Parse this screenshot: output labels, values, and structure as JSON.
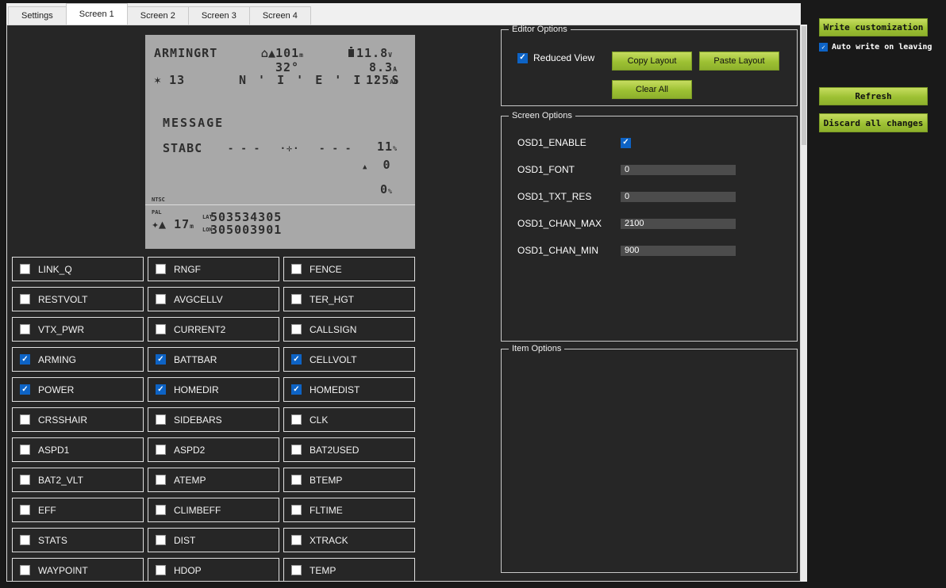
{
  "colors": {
    "accent_green": "#9cc033",
    "checkbox_checked_fill": "#0d63c5",
    "panel_bg": "#262626",
    "window_bg": "#191919",
    "preview_bg": "#a8a8a8",
    "bar_bg": "#4c4c4c"
  },
  "tabs": {
    "items": [
      {
        "label": "Settings",
        "selected": false
      },
      {
        "label": "Screen 1",
        "selected": true
      },
      {
        "label": "Screen 2",
        "selected": false
      },
      {
        "label": "Screen 3",
        "selected": false
      },
      {
        "label": "Screen 4",
        "selected": false
      }
    ]
  },
  "osd": {
    "arming": "ARMINGRT",
    "home_alt": "101",
    "home_alt_unit": "m",
    "heading": "32°",
    "volts": "11.8",
    "volts_unit": "V",
    "amps": "8.3",
    "amps_unit": "A",
    "mah": "125",
    "mah_unit": "Ah",
    "sats": "13",
    "compass": "N ' I ' E ' I ' S",
    "message": "MESSAGE",
    "mode": "STABC",
    "crosshair": "- - -   ·✛·   - - -",
    "rssi": "11",
    "rssi_unit": "%",
    "vspeed": "0",
    "throttle": "0",
    "throttle_unit": "%",
    "ntsc_label": "NTSC",
    "pal_label": "PAL",
    "wind": "17",
    "wind_unit": "m",
    "lat_label": "LAT",
    "lat": "503534305",
    "lon_label": "LON",
    "lon": "305003901",
    "icons": {
      "home_arrow": "⌂▲",
      "satellite": "✶",
      "wind": "✦▲",
      "vspeed_arrow": "▲"
    }
  },
  "items": {
    "columns": [
      [
        {
          "label": "LINK_Q",
          "checked": false
        },
        {
          "label": "RESTVOLT",
          "checked": false
        },
        {
          "label": "VTX_PWR",
          "checked": false
        },
        {
          "label": "ARMING",
          "checked": true
        },
        {
          "label": "POWER",
          "checked": true
        },
        {
          "label": "CRSSHAIR",
          "checked": false
        },
        {
          "label": "ASPD1",
          "checked": false
        },
        {
          "label": "BAT2_VLT",
          "checked": false
        },
        {
          "label": "EFF",
          "checked": false
        },
        {
          "label": "STATS",
          "checked": false
        },
        {
          "label": "WAYPOINT",
          "checked": false
        }
      ],
      [
        {
          "label": "RNGF",
          "checked": false
        },
        {
          "label": "AVGCELLV",
          "checked": false
        },
        {
          "label": "CURRENT2",
          "checked": false
        },
        {
          "label": "BATTBAR",
          "checked": true
        },
        {
          "label": "HOMEDIR",
          "checked": true
        },
        {
          "label": "SIDEBARS",
          "checked": false
        },
        {
          "label": "ASPD2",
          "checked": false
        },
        {
          "label": "ATEMP",
          "checked": false
        },
        {
          "label": "CLIMBEFF",
          "checked": false
        },
        {
          "label": "DIST",
          "checked": false
        },
        {
          "label": "HDOP",
          "checked": false
        }
      ],
      [
        {
          "label": "FENCE",
          "checked": false
        },
        {
          "label": "TER_HGT",
          "checked": false
        },
        {
          "label": "CALLSIGN",
          "checked": false
        },
        {
          "label": "CELLVOLT",
          "checked": true
        },
        {
          "label": "HOMEDIST",
          "checked": true
        },
        {
          "label": "CLK",
          "checked": false
        },
        {
          "label": "BAT2USED",
          "checked": false
        },
        {
          "label": "BTEMP",
          "checked": false
        },
        {
          "label": "FLTIME",
          "checked": false
        },
        {
          "label": "XTRACK",
          "checked": false
        },
        {
          "label": "TEMP",
          "checked": false
        }
      ]
    ]
  },
  "editor_options": {
    "title": "Editor Options",
    "reduced_view_label": "Reduced View",
    "reduced_view_checked": true,
    "copy_button": "Copy Layout",
    "paste_button": "Paste Layout",
    "clear_button": "Clear All"
  },
  "screen_options": {
    "title": "Screen Options",
    "rows": [
      {
        "label": "OSD1_ENABLE",
        "type": "checkbox",
        "checked": true
      },
      {
        "label": "OSD1_FONT",
        "type": "slider",
        "value": "0"
      },
      {
        "label": "OSD1_TXT_RES",
        "type": "slider",
        "value": "0"
      },
      {
        "label": "OSD1_CHAN_MAX",
        "type": "slider",
        "value": "2100"
      },
      {
        "label": "OSD1_CHAN_MIN",
        "type": "slider",
        "value": "900"
      }
    ]
  },
  "item_options": {
    "title": "Item Options"
  },
  "side_panel": {
    "write_button": "Write customization",
    "auto_write_label": "Auto write on leaving",
    "auto_write_checked": true,
    "refresh_button": "Refresh",
    "discard_button": "Discard all changes"
  }
}
